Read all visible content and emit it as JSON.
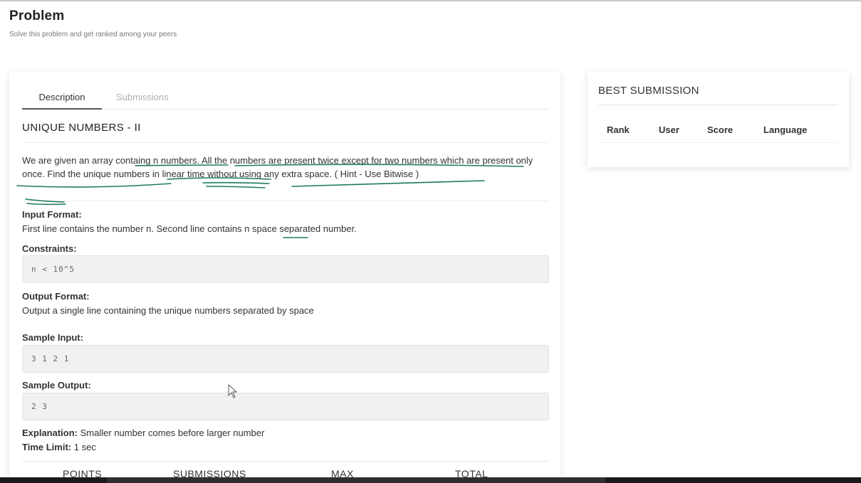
{
  "header": {
    "title": "Problem",
    "subtitle": "Solve this problem and get ranked among your peers"
  },
  "tabs": {
    "description": "Description",
    "submissions": "Submissions"
  },
  "problem": {
    "title": "UNIQUE NUMBERS - II",
    "description": "We are given an array containg n numbers. All the numbers are present twice except for two numbers which are present only once. Find the unique numbers in linear time without using any extra space. ( Hint - Use Bitwise )",
    "input_format_label": "Input Format:",
    "input_format_text": "First line contains the number n. Second line contains n space separated number.",
    "constraints_label": "Constraints:",
    "constraints_value": "n < 10^5",
    "output_format_label": "Output Format:",
    "output_format_text": "Output a single line containing the unique numbers separated by space",
    "sample_input_label": "Sample Input:",
    "sample_input_value": "3 1 2 1",
    "sample_output_label": "Sample Output:",
    "sample_output_value": "2 3",
    "explanation_label": "Explanation:",
    "explanation_text": "Smaller number comes before larger number",
    "time_limit_label": "Time Limit:",
    "time_limit_text": "1 sec"
  },
  "stats_headers": [
    "POINTS",
    "SUBMISSIONS",
    "MAX",
    "TOTAL"
  ],
  "best_submission": {
    "title": "BEST SUBMISSION",
    "columns": [
      "Rank",
      "User",
      "Score",
      "Language"
    ]
  },
  "colors": {
    "annotation_pen": "#1e7a5e",
    "code_box_bg": "#f1f1f1"
  }
}
